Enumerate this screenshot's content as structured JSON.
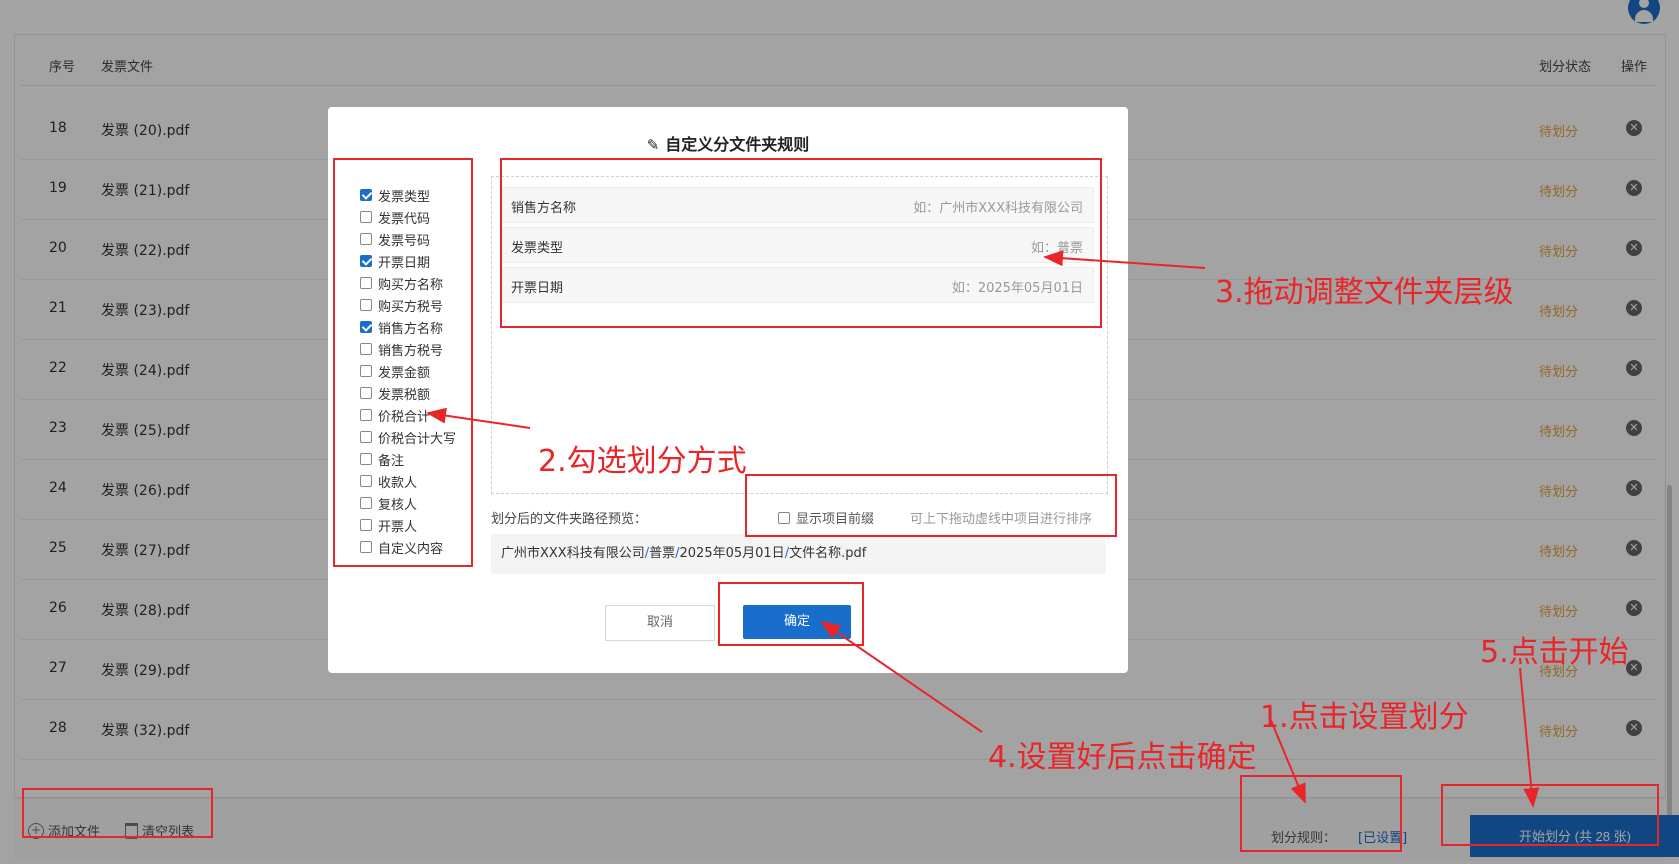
{
  "table": {
    "headers": {
      "no": "序号",
      "file": "发票文件",
      "status": "划分状态",
      "action": "操作"
    },
    "rows": [
      {
        "no": "18",
        "file": "发票 (20).pdf",
        "status": "待划分"
      },
      {
        "no": "19",
        "file": "发票 (21).pdf",
        "status": "待划分"
      },
      {
        "no": "20",
        "file": "发票 (22).pdf",
        "status": "待划分"
      },
      {
        "no": "21",
        "file": "发票 (23).pdf",
        "status": "待划分"
      },
      {
        "no": "22",
        "file": "发票 (24).pdf",
        "status": "待划分"
      },
      {
        "no": "23",
        "file": "发票 (25).pdf",
        "status": "待划分"
      },
      {
        "no": "24",
        "file": "发票 (26).pdf",
        "status": "待划分"
      },
      {
        "no": "25",
        "file": "发票 (27).pdf",
        "status": "待划分"
      },
      {
        "no": "26",
        "file": "发票 (28).pdf",
        "status": "待划分"
      },
      {
        "no": "27",
        "file": "发票 (29).pdf",
        "status": "待划分"
      },
      {
        "no": "28",
        "file": "发票 (32).pdf",
        "status": "待划分"
      }
    ]
  },
  "footer": {
    "add_files": "添加文件",
    "clear_list": "清空列表",
    "rule_label": "划分规则：",
    "rule_value": "[已设置]",
    "start": "开始划分 (共 28 张)"
  },
  "dialog": {
    "title": "自定义分文件夹规则",
    "options": [
      {
        "label": "发票类型",
        "checked": true
      },
      {
        "label": "发票代码",
        "checked": false
      },
      {
        "label": "发票号码",
        "checked": false
      },
      {
        "label": "开票日期",
        "checked": true
      },
      {
        "label": "购买方名称",
        "checked": false
      },
      {
        "label": "购买方税号",
        "checked": false
      },
      {
        "label": "销售方名称",
        "checked": true
      },
      {
        "label": "销售方税号",
        "checked": false
      },
      {
        "label": "发票金额",
        "checked": false
      },
      {
        "label": "发票税额",
        "checked": false
      },
      {
        "label": "价税合计",
        "checked": false
      },
      {
        "label": "价税合计大写",
        "checked": false
      },
      {
        "label": "备注",
        "checked": false
      },
      {
        "label": "收款人",
        "checked": false
      },
      {
        "label": "复核人",
        "checked": false
      },
      {
        "label": "开票人",
        "checked": false
      },
      {
        "label": "自定义内容",
        "checked": false
      }
    ],
    "levels": [
      {
        "name": "销售方名称",
        "example": "如：广州市XXX科技有限公司"
      },
      {
        "name": "发票类型",
        "example": "如：普票"
      },
      {
        "name": "开票日期",
        "example": "如：2025年05月01日"
      }
    ],
    "preview_label": "划分后的文件夹路径预览：",
    "show_prefix": "显示项目前缀",
    "drag_hint": "可上下拖动虚线中项目进行排序",
    "path_parts": [
      "广州市XXX科技有限公司",
      "普票",
      "2025年05月01日",
      "文件名称.pdf"
    ],
    "cancel": "取消",
    "confirm": "确定"
  },
  "annotations": {
    "step1": "1.点击设置划分",
    "step2": "2.勾选划分方式",
    "step3": "3.拖动调整文件夹层级",
    "step4": "4.设置好后点击确定",
    "step5": "5.点击开始"
  },
  "colors": {
    "primary": "#1a6ecb",
    "pending": "#e6a23c",
    "annotation": "#e8262a"
  }
}
